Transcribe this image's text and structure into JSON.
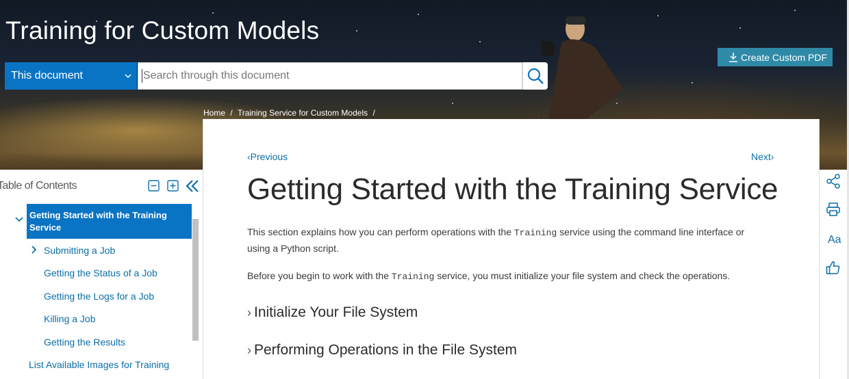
{
  "header": {
    "title": "Training for Custom Models",
    "scope_select": "This document",
    "search_placeholder": "Search through this document",
    "create_pdf_label": "Create Custom PDF"
  },
  "breadcrumb": [
    "Home",
    "/",
    "Training Service for Custom Models",
    "/"
  ],
  "sidebar": {
    "title": "Table of Contents",
    "active_item": "Getting Started with the Training Service",
    "items": [
      "Submitting a Job",
      "Getting the Status of a Job",
      "Getting the Logs for a Job",
      "Killing a Job",
      "Getting the Results",
      "List Available Images for Training"
    ]
  },
  "content": {
    "prev_label": "Previous",
    "next_label": "Next",
    "title": "Getting Started with the Training Service",
    "para1_a": "This section explains how you can perform operations with the ",
    "para1_code": "Training",
    "para1_b": " service using the command line interface or using a Python script.",
    "para2_a": "Before you begin to work with the ",
    "para2_code": "Training",
    "para2_b": " service, you must initialize your file system and check the operations.",
    "sections": [
      "Initialize Your File System",
      "Performing Operations in the File System"
    ]
  },
  "rail": {
    "font_label": "Aa"
  },
  "colors": {
    "primary_blue": "#0a74c4",
    "link_blue": "#0a6ea8",
    "pdf_button": "#2f8aa8"
  }
}
